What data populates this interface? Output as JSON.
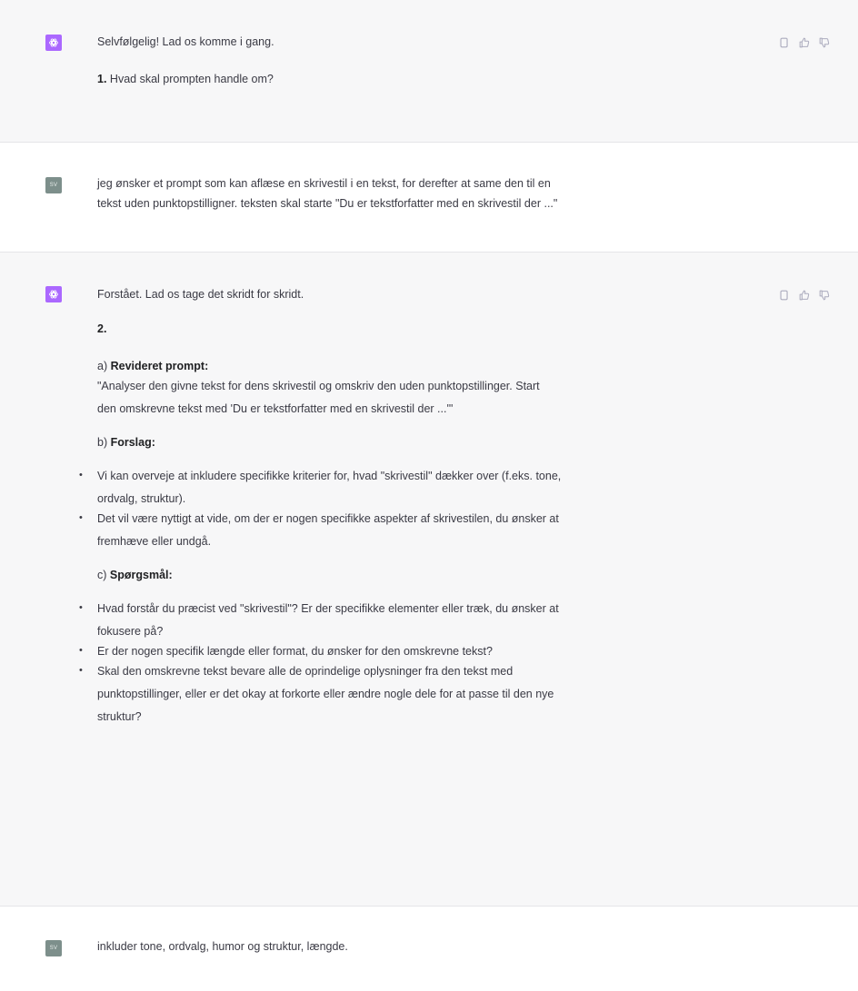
{
  "messages": {
    "m1": {
      "line1": "Selvfølgelig! Lad os komme i gang.",
      "q_num": "1.",
      "q_text": " Hvad skal prompten handle om?"
    },
    "m2": {
      "avatar": "SV",
      "line1": "jeg ønsker et prompt som kan aflæse en skrivestil i en tekst, for derefter at same den til en",
      "line2": "tekst uden punktopstilligner. teksten skal starte \"Du er tekstforfatter med en skrivestil der ...\""
    },
    "m3": {
      "line1": "Forstået. Lad os tage det skridt for skridt.",
      "num": "2.",
      "a_prefix": "a) ",
      "a_label": "Revideret prompt:",
      "a_text1": "\"Analyser den givne tekst for dens skrivestil og omskriv den uden punktopstillinger. Start",
      "a_text2": "den omskrevne tekst med 'Du er tekstforfatter med en skrivestil der ...'\"",
      "b_prefix": "b) ",
      "b_label": "Forslag:",
      "b_items": [
        [
          "Vi kan overveje at inkludere specifikke kriterier for, hvad \"skrivestil\" dækker over (f.eks. tone,",
          "ordvalg, struktur)."
        ],
        [
          "Det vil være nyttigt at vide, om der er nogen specifikke aspekter af skrivestilen, du ønsker at",
          "fremhæve eller undgå."
        ]
      ],
      "c_prefix": "c) ",
      "c_label": "Spørgsmål:",
      "c_items": [
        [
          "Hvad forstår du præcist ved \"skrivestil\"? Er der specifikke elementer eller træk, du ønsker at",
          "fokusere på?"
        ],
        [
          "Er der nogen specifik længde eller format, du ønsker for den omskrevne tekst?"
        ],
        [
          "Skal den omskrevne tekst bevare alle de oprindelige oplysninger fra den tekst med",
          "punktopstillinger, eller er det okay at forkorte eller ændre nogle dele for at passe til den nye",
          "struktur?"
        ]
      ]
    },
    "m4": {
      "avatar": "SV",
      "line1": "inkluder tone, ordvalg, humor og struktur, længde."
    }
  },
  "icons": {
    "copy": "copy-icon",
    "thumbs_up": "thumbs-up-icon",
    "thumbs_down": "thumbs-down-icon",
    "assistant_logo": "openai-logo-icon"
  },
  "colors": {
    "assistant_bg": "#f7f7f8",
    "user_bg": "#ffffff",
    "assistant_avatar": "#ab68ff",
    "user_avatar": "#7d8f8b"
  }
}
